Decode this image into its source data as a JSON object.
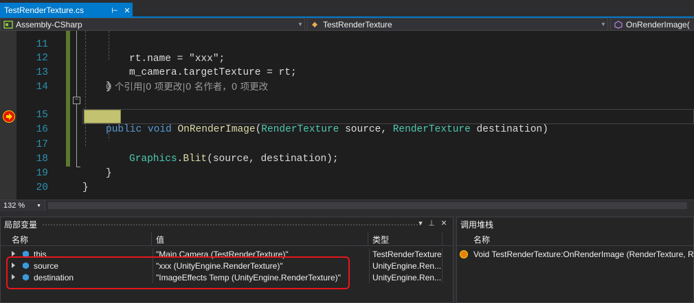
{
  "tab": {
    "title": "TestRenderTexture.cs",
    "pin_glyph": "⊞",
    "close_glyph": "✕"
  },
  "navbar": {
    "project": "Assembly-CSharp",
    "class": "TestRenderTexture",
    "member": "OnRenderImage("
  },
  "editor": {
    "lines": [
      {
        "num": "11",
        "code": "rt.name = \"xxx\";"
      },
      {
        "num": "12",
        "code": "m_camera.targetTexture = rt;"
      },
      {
        "num": "13",
        "code": "}"
      },
      {
        "num": "14",
        "code": ""
      },
      {
        "num": "15",
        "code": "public void OnRenderImage(RenderTexture source, RenderTexture destination)"
      },
      {
        "num": "16",
        "code": "{"
      },
      {
        "num": "17",
        "code": "Graphics.Blit(source, destination);"
      },
      {
        "num": "18",
        "code": "}"
      },
      {
        "num": "19",
        "code": "}"
      },
      {
        "num": "20",
        "code": ""
      }
    ],
    "codelens": "0 个引用|0 项更改|0 名作者，0 项更改",
    "line15": {
      "kw1": "public",
      "kw2": "void",
      "method": "OnRenderImage",
      "type1": "RenderTexture",
      "p1": "source",
      "type2": "RenderTexture",
      "p2": "destination"
    },
    "line17": {
      "type": "Graphics",
      "method": "Blit",
      "args": "(source, destination);"
    },
    "line12": {
      "obj": "m_camera",
      "rest": ".targetTexture = rt;"
    }
  },
  "zoom": {
    "level": "132 %"
  },
  "locals": {
    "title": "局部变量",
    "columns": {
      "name": "名称",
      "value": "值",
      "type": "类型"
    },
    "rows": [
      {
        "name": "this",
        "value": "\"Main Camera (TestRenderTexture)\"",
        "type": "TestRenderTexture"
      },
      {
        "name": "source",
        "value": "\"xxx (UnityEngine.RenderTexture)\"",
        "type": "UnityEngine.Ren..."
      },
      {
        "name": "destination",
        "value": "\"ImageEffects Temp (UnityEngine.RenderTexture)\"",
        "type": "UnityEngine.Ren..."
      }
    ],
    "buttons": {
      "dropdown": "▾",
      "pin": "⊥",
      "close": "✕"
    }
  },
  "callstack": {
    "title": "调用堆栈",
    "columns": {
      "name": "名称"
    },
    "rows": [
      {
        "name": "Void TestRenderTexture:OnRenderImage (RenderTexture, Rend"
      }
    ]
  },
  "colors": {
    "accent": "#007acc",
    "keyword": "#569cd6",
    "type": "#4ec9b0",
    "method": "#dcdcaa",
    "line_number": "#2b91af",
    "highlight_box": "#e8161b"
  }
}
